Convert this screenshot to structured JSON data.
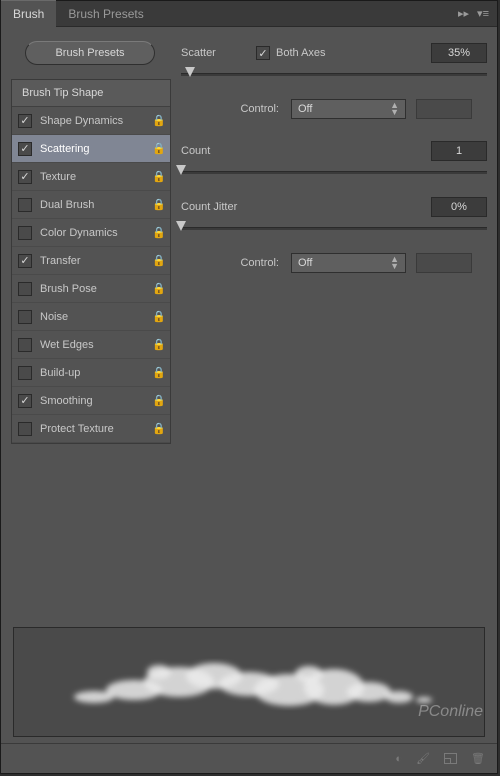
{
  "tabs": {
    "brush": "Brush",
    "presets": "Brush Presets"
  },
  "buttons": {
    "presets": "Brush Presets"
  },
  "list": {
    "header": "Brush Tip Shape",
    "items": [
      {
        "label": "Shape Dynamics",
        "checked": true,
        "locked": true,
        "selected": false
      },
      {
        "label": "Scattering",
        "checked": true,
        "locked": true,
        "selected": true
      },
      {
        "label": "Texture",
        "checked": true,
        "locked": true,
        "selected": false
      },
      {
        "label": "Dual Brush",
        "checked": false,
        "locked": true,
        "selected": false
      },
      {
        "label": "Color Dynamics",
        "checked": false,
        "locked": true,
        "selected": false
      },
      {
        "label": "Transfer",
        "checked": true,
        "locked": true,
        "selected": false
      },
      {
        "label": "Brush Pose",
        "checked": false,
        "locked": true,
        "selected": false
      },
      {
        "label": "Noise",
        "checked": false,
        "locked": true,
        "selected": false
      },
      {
        "label": "Wet Edges",
        "checked": false,
        "locked": true,
        "selected": false
      },
      {
        "label": "Build-up",
        "checked": false,
        "locked": true,
        "selected": false
      },
      {
        "label": "Smoothing",
        "checked": true,
        "locked": true,
        "selected": false
      },
      {
        "label": "Protect Texture",
        "checked": false,
        "locked": true,
        "selected": false
      }
    ]
  },
  "settings": {
    "scatter": {
      "label": "Scatter",
      "both_axes_label": "Both Axes",
      "both_axes": true,
      "value": "35%",
      "slider_pct": 3
    },
    "control1": {
      "label": "Control:",
      "value": "Off"
    },
    "count": {
      "label": "Count",
      "value": "1",
      "slider_pct": 0
    },
    "count_jitter": {
      "label": "Count Jitter",
      "value": "0%",
      "slider_pct": 0
    },
    "control2": {
      "label": "Control:",
      "value": "Off"
    }
  },
  "watermark": "PConline"
}
